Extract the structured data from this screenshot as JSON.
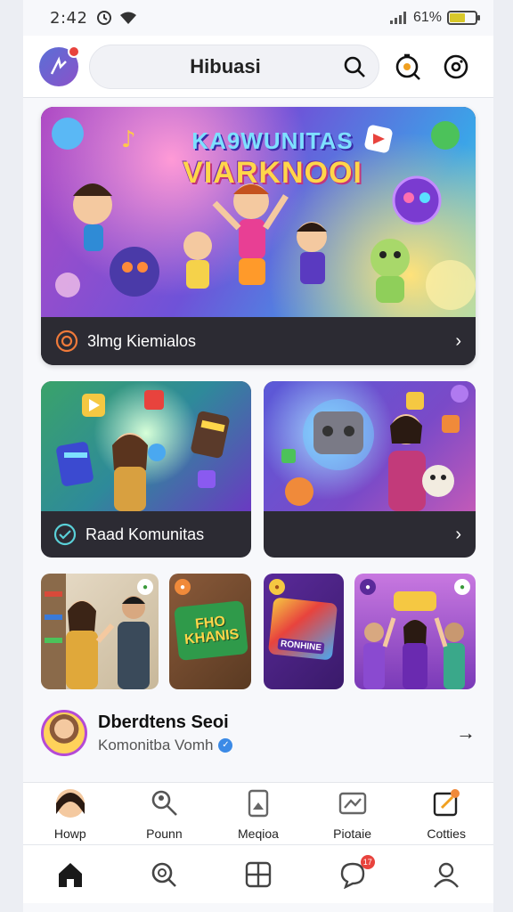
{
  "status": {
    "time": "2:42",
    "battery_text": "61%",
    "battery_level": 0.6
  },
  "header": {
    "search_query": "Hibuasi",
    "notification_count": ""
  },
  "hero": {
    "title_line1": "KA9WUNITAS",
    "title_line2": "VIARKNOOI",
    "footer_label": "3lmg Kiemialos"
  },
  "cards": [
    {
      "label": "Raad Komunitas"
    },
    {
      "label": ""
    }
  ],
  "tiles": [
    {
      "caption": ""
    },
    {
      "caption": "FHO\nKHANIS"
    },
    {
      "caption": "RONHINE"
    },
    {
      "caption": ""
    }
  ],
  "profile": {
    "name": "Dberdtens Seoi",
    "subtitle": "Komonitba Vomh"
  },
  "categories": [
    {
      "label": "Howp",
      "icon": "user-avatar-icon"
    },
    {
      "label": "Pounn",
      "icon": "search-person-icon"
    },
    {
      "label": "Meqioa",
      "icon": "media-icon"
    },
    {
      "label": "Piotaie",
      "icon": "picture-icon"
    },
    {
      "label": "Cotties",
      "icon": "edit-icon"
    }
  ],
  "bottom_nav": {
    "items": [
      "home-icon",
      "search-icon",
      "add-icon",
      "chat-icon",
      "profile-icon"
    ],
    "chat_badge": "17"
  }
}
